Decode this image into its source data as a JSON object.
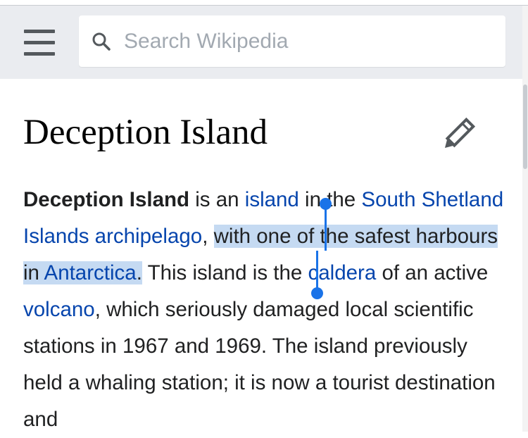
{
  "search": {
    "placeholder": "Search Wikipedia",
    "icon": "search-icon"
  },
  "page": {
    "title": "Deception Island"
  },
  "article": {
    "p1_bold": "Deception Island",
    "p1_t1": " is an ",
    "link_island": "island",
    "p1_t2": " in the ",
    "link_south_shetland": "South Shetland Islands archipelago",
    "p1_t3": ", ",
    "sel_text1": "with one of the safest harbours in ",
    "link_antarctica": "Antarctica",
    "sel_text2": ".",
    "p1_t4": " This island is the ",
    "link_caldera": "caldera",
    "p1_t5": " of an active ",
    "link_volcano": "volcano",
    "p1_t6": ", which seriously damaged local scientific stations in 1967 and 1969. The island previously held a whaling station; it is now a tourist destination and"
  },
  "colors": {
    "link": "#0645ad",
    "selection": "#c5daf2",
    "handle": "#1a73e8",
    "header_bg": "#eaecf0"
  }
}
